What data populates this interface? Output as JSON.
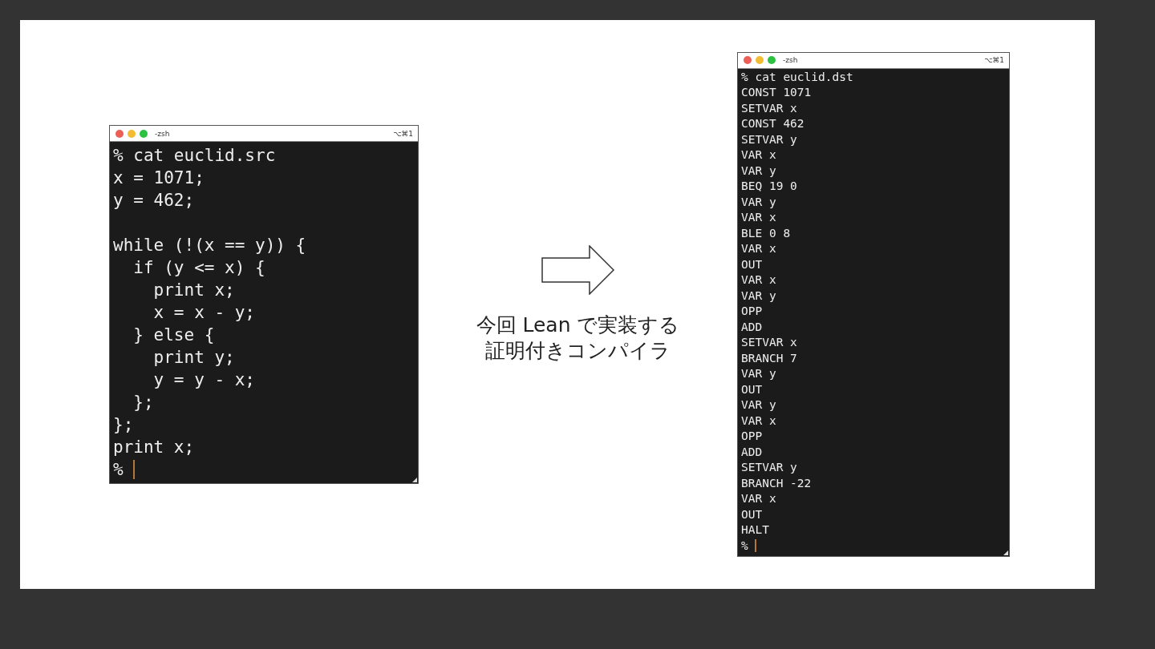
{
  "slide": {
    "source_terminal": {
      "title": "-zsh",
      "shortcut": "⌥⌘1",
      "blocks": [
        [
          "% cat euclid.src",
          "x = 1071;",
          "y = 462;"
        ],
        [
          "while (!(x == y)) {",
          "  if (y <= x) {",
          "    print x;",
          "    x = x - y;",
          "  } else {",
          "    print y;",
          "    y = y - x;",
          "  };",
          "};",
          "print x;"
        ]
      ],
      "prompt": "%"
    },
    "caption": [
      "今回 Lean で実装する",
      "証明付きコンパイラ"
    ],
    "output_terminal": {
      "title": "-zsh",
      "shortcut": "⌥⌘1",
      "blocks": [
        [
          "% cat euclid.dst",
          "CONST 1071",
          "SETVAR x",
          "CONST 462",
          "SETVAR y",
          "VAR x",
          "VAR y",
          "BEQ 19 0",
          "VAR y",
          "VAR x",
          "BLE 0 8",
          "VAR x",
          "OUT",
          "VAR x",
          "VAR y",
          "OPP",
          "ADD",
          "SETVAR x",
          "BRANCH 7",
          "VAR y",
          "OUT",
          "VAR y",
          "VAR x",
          "OPP",
          "ADD",
          "SETVAR y",
          "BRANCH -22",
          "VAR x",
          "OUT",
          "HALT"
        ]
      ],
      "prompt": "%"
    }
  }
}
